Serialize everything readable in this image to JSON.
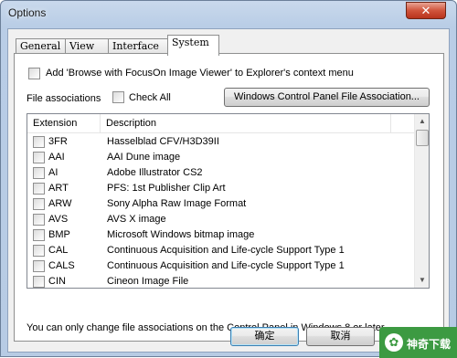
{
  "window": {
    "title": "Options",
    "close_glyph": "✕"
  },
  "tabs": [
    {
      "label": "General"
    },
    {
      "label": "View"
    },
    {
      "label": "Interface"
    },
    {
      "label": "System",
      "active": true
    }
  ],
  "system": {
    "context_menu_label": "Add 'Browse with FocusOn Image Viewer' to Explorer's context menu",
    "file_assoc_label": "File associations",
    "check_all_label": "Check All",
    "control_panel_button": "Windows Control Panel File Association...",
    "note": "You can only change file associations on the Control Panel in Windows 8 or later"
  },
  "list": {
    "columns": [
      "Extension",
      "Description"
    ],
    "rows": [
      {
        "ext": "3FR",
        "desc": "Hasselblad CFV/H3D39II"
      },
      {
        "ext": "AAI",
        "desc": "AAI Dune image"
      },
      {
        "ext": "AI",
        "desc": "Adobe Illustrator CS2"
      },
      {
        "ext": "ART",
        "desc": "PFS: 1st Publisher Clip Art"
      },
      {
        "ext": "ARW",
        "desc": "Sony Alpha Raw Image Format"
      },
      {
        "ext": "AVS",
        "desc": "AVS X image"
      },
      {
        "ext": "BMP",
        "desc": "Microsoft Windows bitmap image"
      },
      {
        "ext": "CAL",
        "desc": "Continuous Acquisition and Life-cycle Support Type 1"
      },
      {
        "ext": "CALS",
        "desc": "Continuous Acquisition and Life-cycle Support Type 1"
      },
      {
        "ext": "CIN",
        "desc": "Cineon Image File"
      }
    ],
    "scroll_up": "▲",
    "scroll_down": "▼"
  },
  "buttons": {
    "ok": "确定",
    "cancel": "取消"
  },
  "watermark": {
    "icon": "✿",
    "text": "神奇下载"
  }
}
